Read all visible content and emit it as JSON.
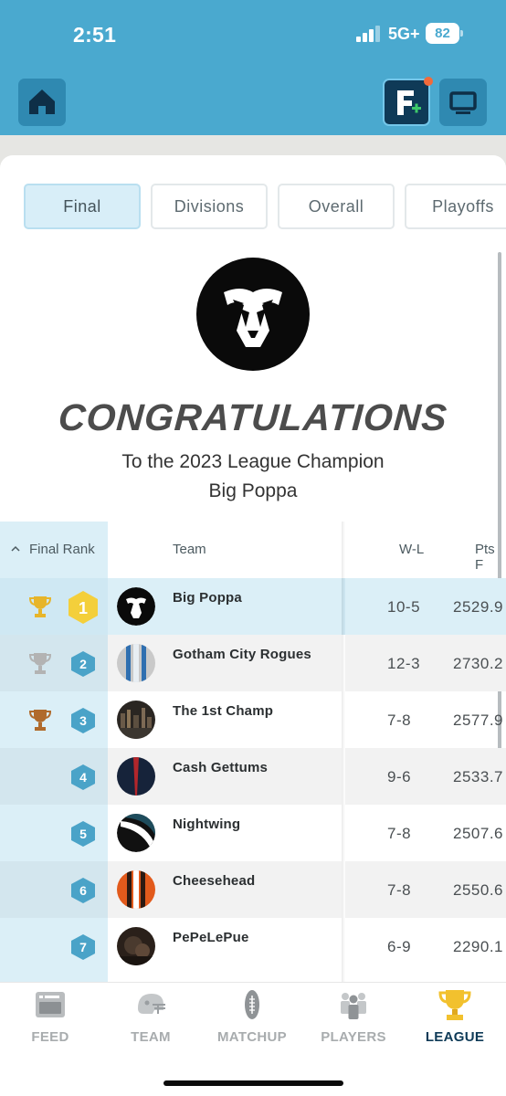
{
  "status_bar": {
    "time": "2:51",
    "network": "5G+",
    "battery": "82"
  },
  "colors": {
    "accent": "#4aa9cf",
    "gold": "#e7b52a",
    "silver": "#b3b3b3",
    "bronze": "#b06a2b",
    "badge": "#4aa3c8",
    "dark_navy": "#0e3a57"
  },
  "header": {
    "home_icon": "home-icon",
    "fplus_icon": "f-plus-icon",
    "tv_icon": "tv-icon"
  },
  "tabs": [
    {
      "label": "Final",
      "active": true
    },
    {
      "label": "Divisions",
      "active": false
    },
    {
      "label": "Overall",
      "active": false
    },
    {
      "label": "Playoffs",
      "active": false
    }
  ],
  "champion": {
    "heading": "CONGRATULATIONS",
    "line1": "To the 2023 League Champion",
    "line2": "Big Poppa"
  },
  "table": {
    "columns": {
      "rank": "Final Rank",
      "team": "Team",
      "wl": "W-L",
      "pts": "Pts F"
    },
    "rows": [
      {
        "rank": "1",
        "trophy": "gold",
        "team": "Big Poppa",
        "wl": "10-5",
        "pts": "2529.9"
      },
      {
        "rank": "2",
        "trophy": "silver",
        "team": "Gotham City Rogues",
        "wl": "12-3",
        "pts": "2730.2"
      },
      {
        "rank": "3",
        "trophy": "bronze",
        "team": "The 1st Champ",
        "wl": "7-8",
        "pts": "2577.9"
      },
      {
        "rank": "4",
        "trophy": "",
        "team": "Cash Gettums",
        "wl": "9-6",
        "pts": "2533.7"
      },
      {
        "rank": "5",
        "trophy": "",
        "team": "Nightwing",
        "wl": "7-8",
        "pts": "2507.6"
      },
      {
        "rank": "6",
        "trophy": "",
        "team": "Cheesehead",
        "wl": "7-8",
        "pts": "2550.6"
      },
      {
        "rank": "7",
        "trophy": "",
        "team": "PePeLePue",
        "wl": "6-9",
        "pts": "2290.1"
      }
    ]
  },
  "bottom_nav": [
    {
      "label": "FEED",
      "icon": "feed-icon",
      "active": false
    },
    {
      "label": "TEAM",
      "icon": "helmet-icon",
      "active": false
    },
    {
      "label": "MATCHUP",
      "icon": "football-icon",
      "active": false
    },
    {
      "label": "PLAYERS",
      "icon": "players-icon",
      "active": false
    },
    {
      "label": "LEAGUE",
      "icon": "trophy-icon",
      "active": true
    }
  ]
}
